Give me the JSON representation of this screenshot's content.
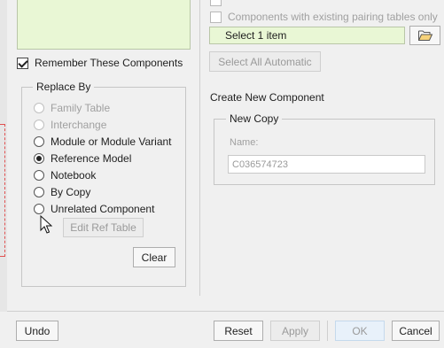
{
  "left_panel": {
    "remember_label": "Remember These Components",
    "replace_by": {
      "title": "Replace By",
      "options": [
        {
          "label": "Family Table",
          "enabled": false,
          "selected": false
        },
        {
          "label": "Interchange",
          "enabled": false,
          "selected": false
        },
        {
          "label": "Module or Module Variant",
          "enabled": true,
          "selected": false
        },
        {
          "label": "Reference Model",
          "enabled": true,
          "selected": true
        },
        {
          "label": "Notebook",
          "enabled": true,
          "selected": false
        },
        {
          "label": "By Copy",
          "enabled": true,
          "selected": false
        },
        {
          "label": "Unrelated Component",
          "enabled": true,
          "selected": false
        }
      ],
      "edit_ref_table_label": "Edit Ref Table",
      "clear_label": "Clear"
    }
  },
  "right_panel": {
    "pairing_label": "Components with existing pairing tables only",
    "select_item_label": "Select 1 item",
    "select_all_label": "Select All Automatic",
    "create_new_label": "Create New Component",
    "new_copy": {
      "title": "New Copy",
      "name_label": "Name:",
      "name_value": "C036574723"
    }
  },
  "footer": {
    "undo_label": "Undo",
    "reset_label": "Reset",
    "apply_label": "Apply",
    "ok_label": "OK",
    "cancel_label": "Cancel"
  },
  "icons": {
    "open_folder": "open-folder-icon",
    "cursor": "mouse-cursor-icon"
  }
}
